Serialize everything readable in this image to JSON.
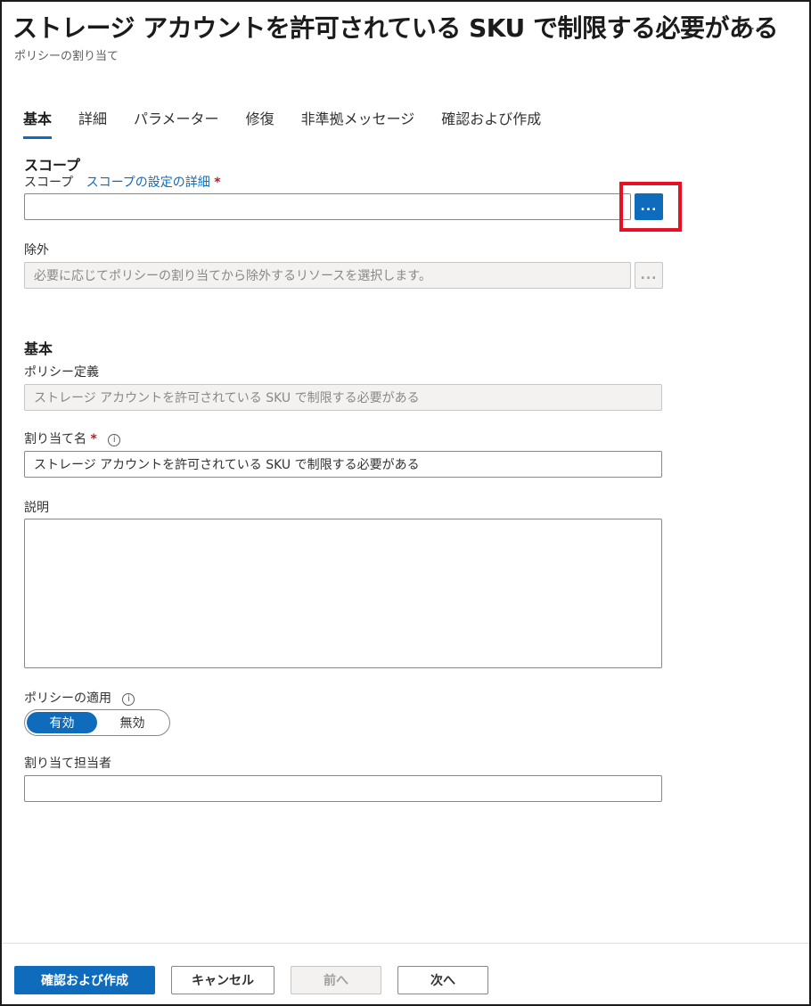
{
  "header": {
    "title": "ストレージ アカウントを許可されている SKU で制限する必要がある",
    "more_icon": "…",
    "subtitle": "ポリシーの割り当て"
  },
  "tabs": [
    {
      "label": "基本",
      "active": true
    },
    {
      "label": "詳細",
      "active": false
    },
    {
      "label": "パラメーター",
      "active": false
    },
    {
      "label": "修復",
      "active": false
    },
    {
      "label": "非準拠メッセージ",
      "active": false
    },
    {
      "label": "確認および作成",
      "active": false
    }
  ],
  "scope_section": {
    "heading": "スコープ",
    "scope_label": "スコープ",
    "scope_link": "スコープの設定の詳細",
    "required_mark": "*",
    "scope_value": "",
    "picker_label": "...",
    "exclusions_label": "除外",
    "exclusions_placeholder": "必要に応じてポリシーの割り当てから除外するリソースを選択します。",
    "exclusions_picker_label": "..."
  },
  "basics_section": {
    "heading": "基本",
    "policy_definition_label": "ポリシー定義",
    "policy_definition_value": "ストレージ アカウントを許可されている SKU で制限する必要がある",
    "assignment_name_label": "割り当て名",
    "assignment_name_required": "*",
    "assignment_name_value": "ストレージ アカウントを許可されている SKU で制限する必要がある",
    "description_label": "説明",
    "description_value": "",
    "enforcement_label": "ポリシーの適用",
    "enforcement_options": [
      "有効",
      "無効"
    ],
    "enforcement_selected": "有効",
    "assigned_by_label": "割り当て担当者",
    "assigned_by_value": "",
    "info_icon": "i"
  },
  "footer": {
    "review_create": "確認および作成",
    "cancel": "キャンセル",
    "previous": "前へ",
    "next": "次へ"
  },
  "colors": {
    "accent": "#0f6cbd",
    "highlight": "#e81123",
    "required": "#a4262c"
  }
}
